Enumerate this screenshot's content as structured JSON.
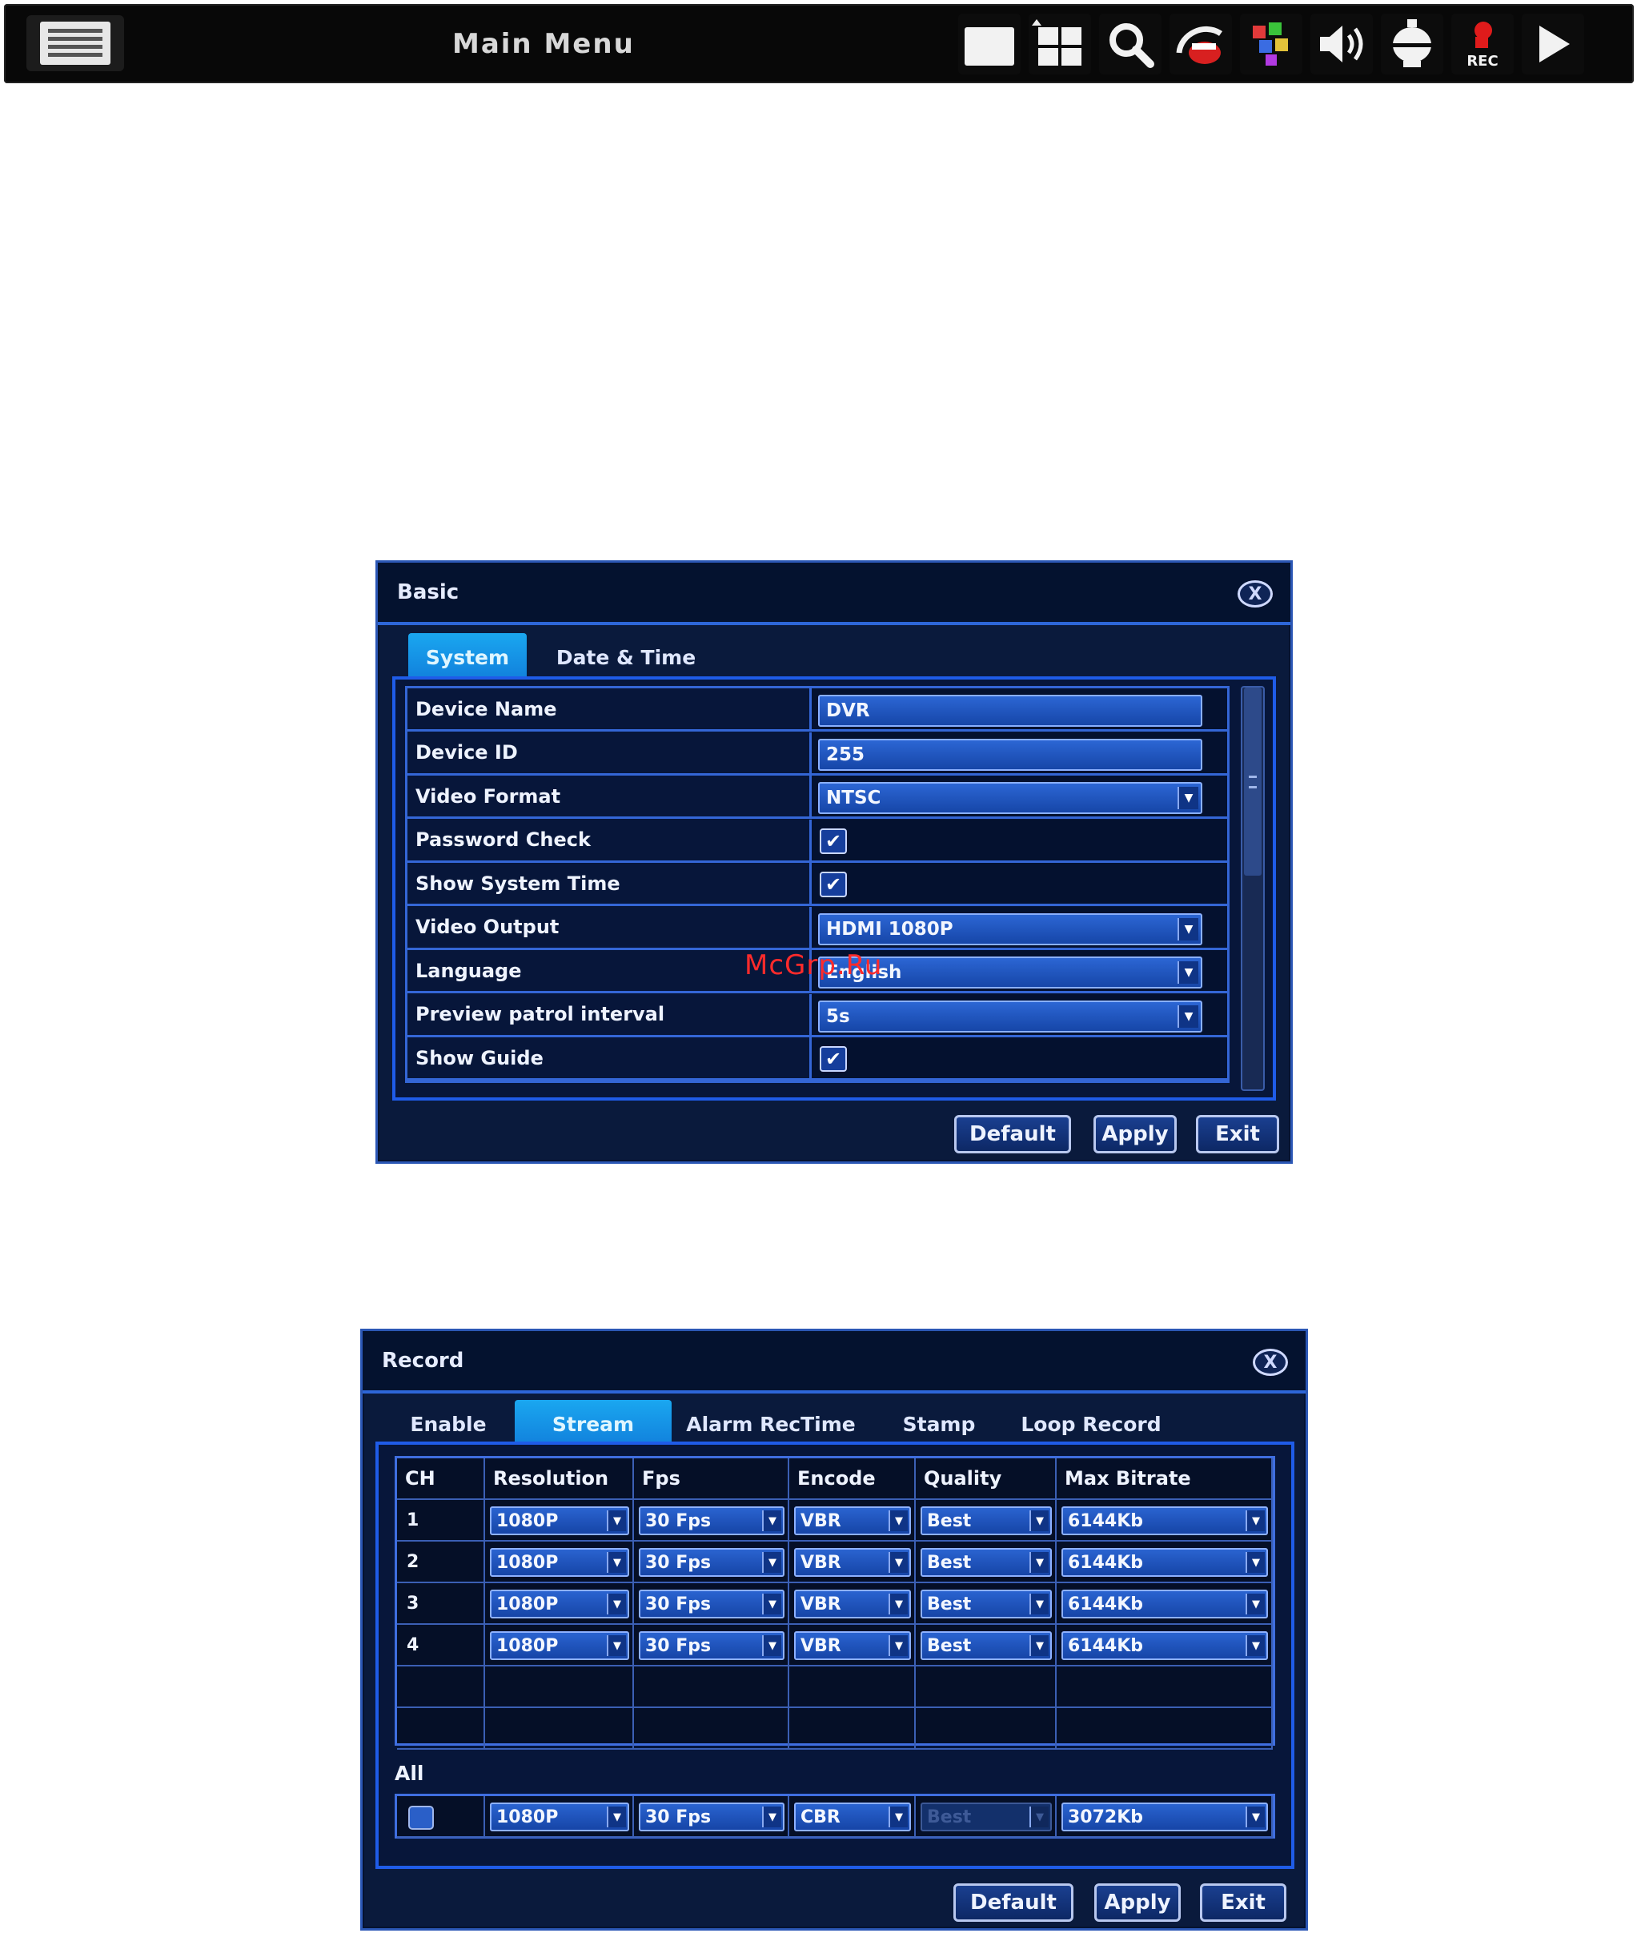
{
  "toolbar": {
    "title": "Main  Menu",
    "icons": [
      "menu-icon",
      "single-view-icon",
      "quad-view-icon",
      "search-icon",
      "ptz-icon",
      "color-icon",
      "volume-icon",
      "dome-camera-icon",
      "record-icon",
      "play-icon"
    ],
    "rec_label": "REC"
  },
  "basic": {
    "title": "Basic",
    "close": "X",
    "tabs": [
      "System",
      "Date  &  Time"
    ],
    "rows": [
      {
        "label": "Device  Name",
        "type": "text",
        "value": "DVR"
      },
      {
        "label": "Device  ID",
        "type": "text",
        "value": "255"
      },
      {
        "label": "Video  Format",
        "type": "select",
        "value": "NTSC"
      },
      {
        "label": "Password  Check",
        "type": "check",
        "value": "checked"
      },
      {
        "label": "Show  System  Time",
        "type": "check",
        "value": "checked"
      },
      {
        "label": "Video  Output",
        "type": "select",
        "value": "HDMI  1080P"
      },
      {
        "label": "Language",
        "type": "select",
        "value": "English"
      },
      {
        "label": "Preview  patrol  interval",
        "type": "select",
        "value": "5s"
      },
      {
        "label": "Show  Guide",
        "type": "check",
        "value": "checked"
      }
    ],
    "buttons": {
      "default": "Default",
      "apply": "Apply",
      "exit": "Exit"
    }
  },
  "record": {
    "title": "Record",
    "close": "X",
    "tabs": [
      "Enable",
      "Stream",
      "Alarm  RecTime",
      "Stamp",
      "Loop  Record"
    ],
    "columns": [
      "CH",
      "Resolution",
      "Fps",
      "Encode",
      "Quality",
      "Max  Bitrate"
    ],
    "rows": [
      {
        "ch": "1",
        "resolution": "1080P",
        "fps": "30  Fps",
        "encode": "VBR",
        "quality": "Best",
        "bitrate": "6144Kb"
      },
      {
        "ch": "2",
        "resolution": "1080P",
        "fps": "30  Fps",
        "encode": "VBR",
        "quality": "Best",
        "bitrate": "6144Kb"
      },
      {
        "ch": "3",
        "resolution": "1080P",
        "fps": "30  Fps",
        "encode": "VBR",
        "quality": "Best",
        "bitrate": "6144Kb"
      },
      {
        "ch": "4",
        "resolution": "1080P",
        "fps": "30  Fps",
        "encode": "VBR",
        "quality": "Best",
        "bitrate": "6144Kb"
      }
    ],
    "all": {
      "label": "All",
      "resolution": "1080P",
      "fps": "30  Fps",
      "encode": "CBR",
      "quality": "Best",
      "bitrate": "3072Kb"
    },
    "buttons": {
      "default": "Default",
      "apply": "Apply",
      "exit": "Exit"
    }
  },
  "watermark": "McGrp.Ru",
  "colors": {
    "panel_bg": "#07163a",
    "accent": "#1f5ce8",
    "active_tab": "#1aa7f0",
    "rec_red": "#e01b1b"
  }
}
